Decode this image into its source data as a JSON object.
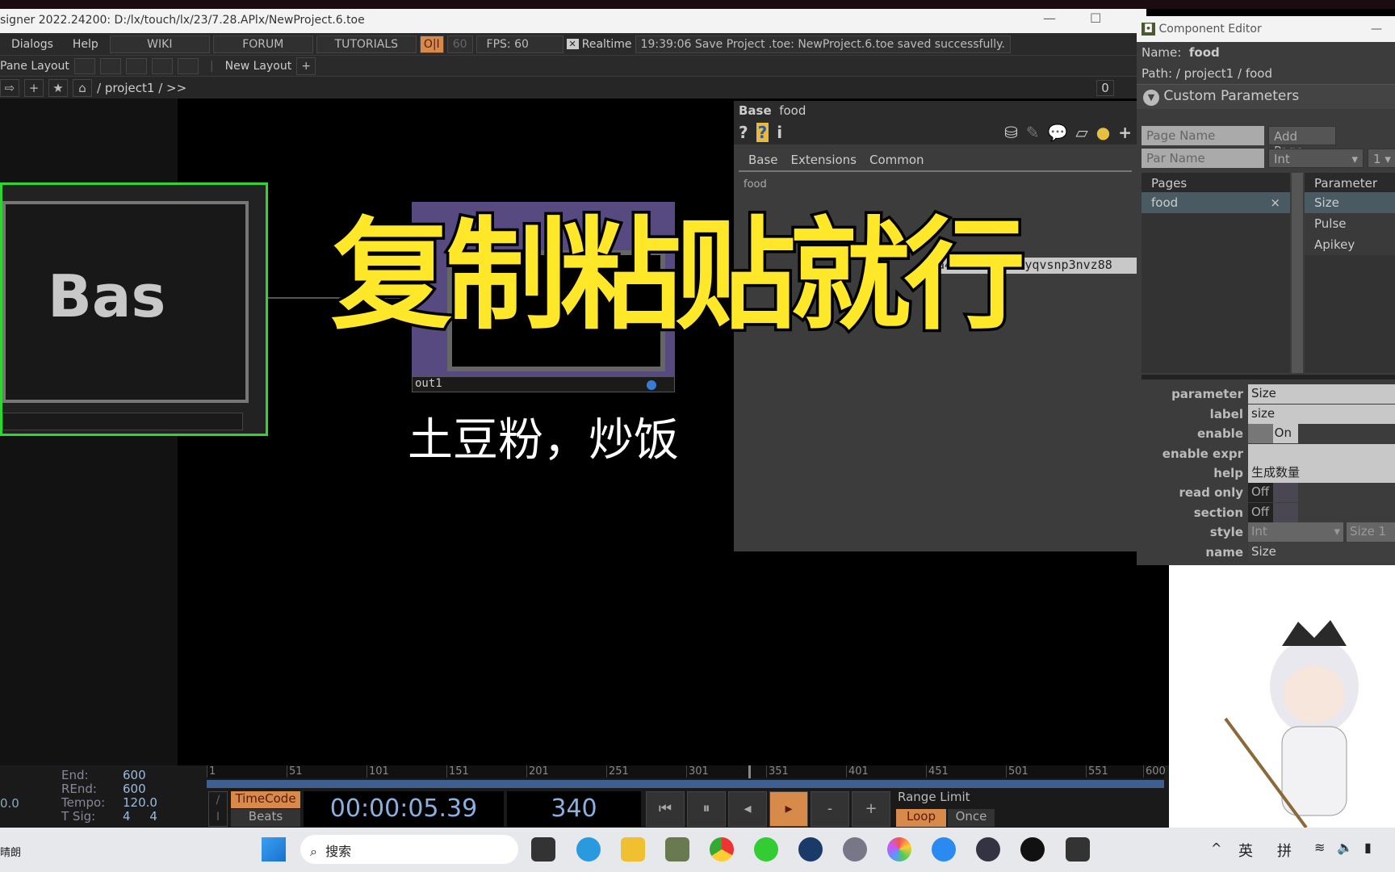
{
  "window": {
    "title": "signer 2022.24200: D:/lx/touch/lx/23/7.28.APlx/NewProject.6.toe"
  },
  "menu": {
    "items": [
      "Dialogs",
      "Help"
    ],
    "links": [
      "WIKI",
      "FORUM",
      "TUTORIALS"
    ],
    "oi": "O|I",
    "fps_target": "60",
    "fps": "FPS:  60",
    "realtime": "Realtime",
    "status": "19:39:06 Save Project .toe: NewProject.6.toe saved successfully."
  },
  "pane": {
    "label": "Pane Layout",
    "new_layout": "New Layout"
  },
  "path": {
    "value": "/ project1 / >>",
    "counter": "0"
  },
  "network": {
    "node_bas": "Bas",
    "node_out": "out1"
  },
  "overlay": {
    "title": "复制粘贴就行",
    "subtitle": "土豆粉，炒饭"
  },
  "params": {
    "type": "Base",
    "name": "food",
    "tabs": [
      "Base",
      "Extensions",
      "Common"
    ],
    "page": "food",
    "field_value": "0a49u   wm2k0rnyqvsnp3nvz88"
  },
  "component_editor": {
    "title": "Component Editor",
    "name_label": "Name:",
    "name": "food",
    "path_label": "Path:",
    "path": "/ project1 / food",
    "section": "Custom Parameters",
    "page_name_placeholder": "Page Name",
    "add_page": "Add Page",
    "par_name_placeholder": "Par Name",
    "type": "Int",
    "count": "1",
    "pages_header": "Pages",
    "pages": [
      "food"
    ],
    "param_header": "Parameter",
    "parameters": [
      "Size",
      "Pulse",
      "Apikey"
    ],
    "props": [
      {
        "k": "parameter",
        "v": "Size"
      },
      {
        "k": "label",
        "v": "size"
      },
      {
        "k": "enable",
        "v": "On"
      },
      {
        "k": "enable expr",
        "v": ""
      },
      {
        "k": "help",
        "v": "生成数量"
      },
      {
        "k": "read only",
        "v": "Off"
      },
      {
        "k": "section",
        "v": "Off"
      },
      {
        "k": "style",
        "v": "Int",
        "v2": "Size 1"
      },
      {
        "k": "name",
        "v": "Size"
      }
    ]
  },
  "timeline": {
    "left_value": "0.0",
    "end_label": "End:",
    "end": "600",
    "rend_label": "REnd:",
    "rend": "600",
    "tempo_label": "Tempo:",
    "tempo": "120.0",
    "tsig_label": "T Sig:",
    "tsig": "4     4",
    "ticks": [
      "1",
      "51",
      "101",
      "151",
      "201",
      "251",
      "301",
      "351",
      "401",
      "451",
      "501",
      "551",
      "600"
    ],
    "current_frame": 340,
    "timecode_btn": "TimeCode",
    "beats_btn": "Beats",
    "timecode": "00:00:05.39",
    "frame": "340",
    "range_limit": "Range Limit",
    "loop": "Loop",
    "once": "Once"
  },
  "taskbar": {
    "weather": "晴朗",
    "search": "搜索",
    "lang": "英",
    "ime": "拼"
  },
  "colors": {
    "accent": "#d88a4a",
    "selected_node": "#2fd62f",
    "overlay_text": "#ffe82a"
  }
}
